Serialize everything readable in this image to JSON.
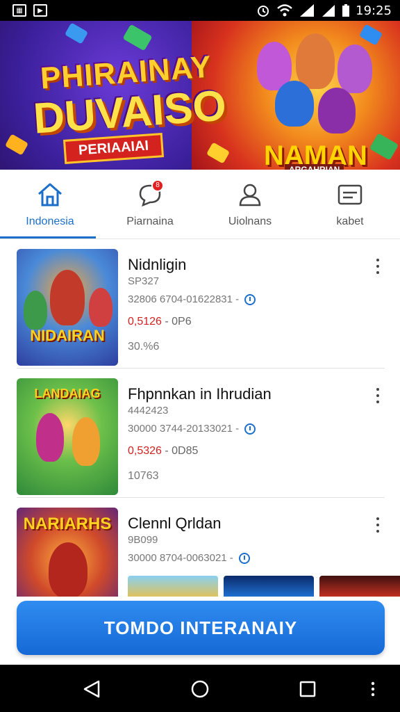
{
  "status_bar": {
    "time": "19:25"
  },
  "banner": {
    "title_line1": "PHIRAINAY",
    "title_line2": "DUVAISO",
    "ribbon": "PERIAAIAI",
    "right_title": "NAMAN",
    "right_subtitle": "ARGAHRIAN"
  },
  "tabs": [
    {
      "label": "Indonesia",
      "icon": "home-icon",
      "active": true
    },
    {
      "label": "Piarnaina",
      "icon": "chat-bubble-icon",
      "badge": "8"
    },
    {
      "label": "Uiolnans",
      "icon": "person-icon"
    },
    {
      "label": "kabet",
      "icon": "card-icon"
    }
  ],
  "items": [
    {
      "title": "Nidnligin",
      "subtitle": "SP327",
      "meta": "32806 6704-01622831 -",
      "price_red": "0,5126",
      "price_rest": " - 0P6",
      "count": "30.%6",
      "thumb_text": "NIDAIRAN"
    },
    {
      "title": "Fhpnnkan in Ihrudian",
      "subtitle": "4442423",
      "meta": "30000 3744-20133021 -",
      "price_red": "0,5326",
      "price_rest": " - 0D85",
      "count": "10763",
      "thumb_text": "LANDAIAG"
    },
    {
      "title": "Clennl Qrldan",
      "subtitle": "9B099",
      "meta": "30000 8704-0063021 -",
      "thumb_text": "NARIARHS"
    }
  ],
  "cta": {
    "label": "TOMDO INTERANAIY"
  },
  "colors": {
    "accent": "#1b6fc9",
    "price_red": "#d32020",
    "cta_top": "#2f8cf0",
    "cta_bottom": "#1669d6"
  }
}
